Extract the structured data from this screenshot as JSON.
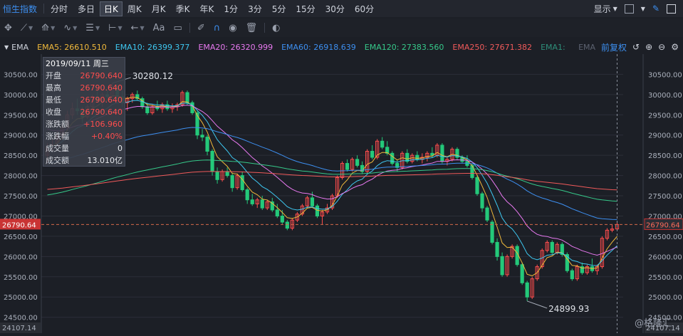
{
  "topbar": {
    "title": "恒生指数",
    "periods": [
      "分时",
      "多日",
      "日K",
      "周K",
      "月K",
      "季K",
      "年K",
      "1分",
      "3分",
      "5分",
      "15分",
      "30分",
      "60分"
    ],
    "active_period": "日K",
    "display_label": "显示"
  },
  "toolbar": {
    "text_tool": "Aa"
  },
  "ema": {
    "label": "EMA",
    "items": [
      {
        "text": "EMA5: 26610.510",
        "color": "#f0b93b"
      },
      {
        "text": "EMA10: 26399.377",
        "color": "#3ec7f0"
      },
      {
        "text": "EMA20: 26320.999",
        "color": "#e879f0"
      },
      {
        "text": "EMA60: 26918.639",
        "color": "#3d8ff0"
      },
      {
        "text": "EMA120: 27383.560",
        "color": "#36c98a"
      },
      {
        "text": "EMA250: 27671.382",
        "color": "#f05a5a"
      },
      {
        "text": "EMA1:",
        "color": "#2e8f7a"
      }
    ],
    "dim_ema": "EMA",
    "adjust_label": "前复权"
  },
  "info": {
    "date": "2019/09/11 周三",
    "rows": [
      {
        "k": "开盘",
        "v": "26790.640",
        "c": "red"
      },
      {
        "k": "最高",
        "v": "26790.640",
        "c": "red"
      },
      {
        "k": "最低",
        "v": "26790.640",
        "c": "red"
      },
      {
        "k": "收盘",
        "v": "26790.640",
        "c": "red"
      },
      {
        "k": "涨跌额",
        "v": "+106.960",
        "c": "red"
      },
      {
        "k": "涨跌幅",
        "v": "+0.40%",
        "c": "red"
      },
      {
        "k": "成交量",
        "v": "0",
        "c": "white"
      },
      {
        "k": "成交额",
        "v": "13.010亿",
        "c": "white"
      }
    ]
  },
  "chart_data": {
    "type": "candlestick",
    "y_ticks": [
      30500,
      30000,
      29500,
      29000,
      28500,
      28000,
      27500,
      27000,
      26500,
      26000,
      25500,
      25000,
      24500
    ],
    "ylim": [
      24107.14,
      31000
    ],
    "y_tick_labels": [
      "30500.00",
      "30000.00",
      "29500.00",
      "29000.00",
      "28500.00",
      "28000.00",
      "27500.00",
      "27000.00",
      "26500.00",
      "26000.00",
      "25500.00",
      "25000.00",
      "24500.00"
    ],
    "current_price": 26790.64,
    "current_price_label": "26790.64",
    "bottom_label": "24107.14",
    "max_label": "30280.12",
    "min_label": "24899.93",
    "candles": [
      [
        28500,
        28800,
        28300,
        28700
      ],
      [
        28700,
        28900,
        28600,
        28750
      ],
      [
        28750,
        29100,
        28700,
        29000
      ],
      [
        29000,
        29300,
        28900,
        29200
      ],
      [
        29200,
        29600,
        29100,
        29500
      ],
      [
        29500,
        29800,
        29400,
        29650
      ],
      [
        29650,
        29900,
        29500,
        29600
      ],
      [
        29600,
        29700,
        29300,
        29450
      ],
      [
        29450,
        29750,
        29400,
        29700
      ],
      [
        29700,
        30000,
        29650,
        29950
      ],
      [
        29950,
        30100,
        29800,
        29850
      ],
      [
        29850,
        30050,
        29700,
        30000
      ],
      [
        30000,
        30150,
        29900,
        29950
      ],
      [
        29950,
        30280,
        29900,
        30200
      ],
      [
        30200,
        30250,
        29900,
        29950
      ],
      [
        29950,
        30100,
        29700,
        29800
      ],
      [
        29800,
        29950,
        29600,
        29900
      ],
      [
        29900,
        30050,
        29800,
        30000
      ],
      [
        30000,
        30100,
        29850,
        29900
      ],
      [
        29900,
        29950,
        29650,
        29700
      ],
      [
        29700,
        29800,
        29500,
        29550
      ],
      [
        29550,
        29750,
        29500,
        29700
      ],
      [
        29700,
        29850,
        29600,
        29650
      ],
      [
        29650,
        29800,
        29550,
        29750
      ],
      [
        29750,
        29850,
        29600,
        29650
      ],
      [
        29650,
        29780,
        29550,
        29700
      ],
      [
        29700,
        29800,
        29600,
        29750
      ],
      [
        29750,
        30100,
        29700,
        30050
      ],
      [
        30050,
        30100,
        29750,
        29800
      ],
      [
        29800,
        29850,
        29500,
        29550
      ],
      [
        29550,
        29600,
        28900,
        29000
      ],
      [
        29000,
        29150,
        28850,
        28950
      ],
      [
        28950,
        29000,
        28500,
        28600
      ],
      [
        28600,
        28650,
        28000,
        28100
      ],
      [
        28100,
        28200,
        27800,
        27900
      ],
      [
        27900,
        28150,
        27850,
        28100
      ],
      [
        28100,
        28200,
        27950,
        28000
      ],
      [
        28000,
        28050,
        27600,
        27700
      ],
      [
        27700,
        28050,
        27650,
        28000
      ],
      [
        28000,
        28100,
        27600,
        27650
      ],
      [
        27650,
        27700,
        27300,
        27400
      ],
      [
        27400,
        27550,
        27250,
        27300
      ],
      [
        27300,
        27450,
        27200,
        27400
      ],
      [
        27400,
        27500,
        27150,
        27200
      ],
      [
        27200,
        27400,
        27150,
        27350
      ],
      [
        27350,
        27450,
        27100,
        27150
      ],
      [
        27150,
        27300,
        26950,
        27000
      ],
      [
        27000,
        27150,
        26800,
        26850
      ],
      [
        26850,
        26900,
        26650,
        26700
      ],
      [
        26700,
        26950,
        26650,
        26900
      ],
      [
        26900,
        27100,
        26850,
        27050
      ],
      [
        27050,
        27300,
        27000,
        27250
      ],
      [
        27250,
        27500,
        27200,
        27450
      ],
      [
        27450,
        27600,
        27200,
        27250
      ],
      [
        27250,
        27300,
        26950,
        27000
      ],
      [
        27000,
        27150,
        26800,
        27100
      ],
      [
        27100,
        27300,
        27050,
        27200
      ],
      [
        27200,
        27550,
        27150,
        27500
      ],
      [
        27500,
        28000,
        27450,
        27950
      ],
      [
        27950,
        28350,
        27900,
        28300
      ],
      [
        28300,
        28400,
        28100,
        28150
      ],
      [
        28150,
        28450,
        28100,
        28400
      ],
      [
        28400,
        28500,
        28200,
        28250
      ],
      [
        28250,
        28350,
        28050,
        28100
      ],
      [
        28100,
        28650,
        28050,
        28600
      ],
      [
        28600,
        28750,
        28400,
        28450
      ],
      [
        28450,
        28900,
        28400,
        28850
      ],
      [
        28850,
        28950,
        28650,
        28700
      ],
      [
        28700,
        28850,
        28500,
        28550
      ],
      [
        28550,
        28600,
        28250,
        28300
      ],
      [
        28300,
        28400,
        28100,
        28200
      ],
      [
        28200,
        28600,
        28150,
        28550
      ],
      [
        28550,
        28650,
        28300,
        28350
      ],
      [
        28350,
        28550,
        28300,
        28500
      ],
      [
        28500,
        28600,
        28350,
        28400
      ],
      [
        28400,
        28550,
        28300,
        28450
      ],
      [
        28450,
        28600,
        28350,
        28550
      ],
      [
        28550,
        28700,
        28450,
        28500
      ],
      [
        28500,
        28800,
        28450,
        28750
      ],
      [
        28750,
        28800,
        28300,
        28350
      ],
      [
        28350,
        28450,
        28250,
        28400
      ],
      [
        28400,
        28700,
        28350,
        28650
      ],
      [
        28650,
        28700,
        28400,
        28450
      ],
      [
        28450,
        28500,
        28300,
        28350
      ],
      [
        28350,
        28500,
        28200,
        28250
      ],
      [
        28250,
        28300,
        27900,
        27950
      ],
      [
        27950,
        28000,
        27500,
        27550
      ],
      [
        27550,
        27600,
        27100,
        27200
      ],
      [
        27200,
        27250,
        26850,
        26900
      ],
      [
        26850,
        26900,
        26300,
        26350
      ],
      [
        26350,
        26450,
        25900,
        26000
      ],
      [
        26000,
        26100,
        25500,
        25550
      ],
      [
        25550,
        26050,
        25500,
        26000
      ],
      [
        26000,
        26300,
        25950,
        26250
      ],
      [
        26250,
        26300,
        25750,
        25800
      ],
      [
        25800,
        25850,
        25300,
        25350
      ],
      [
        25350,
        25400,
        24900,
        25000
      ],
      [
        25000,
        25500,
        24950,
        25450
      ],
      [
        25450,
        25800,
        25400,
        25750
      ],
      [
        25750,
        26200,
        25700,
        26150
      ],
      [
        26150,
        26400,
        26100,
        26350
      ],
      [
        26350,
        26400,
        26050,
        26100
      ],
      [
        26100,
        26350,
        26050,
        26300
      ],
      [
        26300,
        26350,
        26000,
        26050
      ],
      [
        26050,
        26100,
        25600,
        25650
      ],
      [
        25650,
        25700,
        25400,
        25450
      ],
      [
        25450,
        25800,
        25400,
        25750
      ],
      [
        25750,
        25850,
        25550,
        25600
      ],
      [
        25600,
        25800,
        25550,
        25750
      ],
      [
        25750,
        25950,
        25600,
        25650
      ],
      [
        25650,
        25800,
        25550,
        25750
      ],
      [
        25750,
        26500,
        25700,
        26450
      ],
      [
        26450,
        26700,
        26400,
        26650
      ],
      [
        26650,
        26800,
        26600,
        26680
      ],
      [
        26680,
        26850,
        26650,
        26790
      ]
    ]
  }
}
